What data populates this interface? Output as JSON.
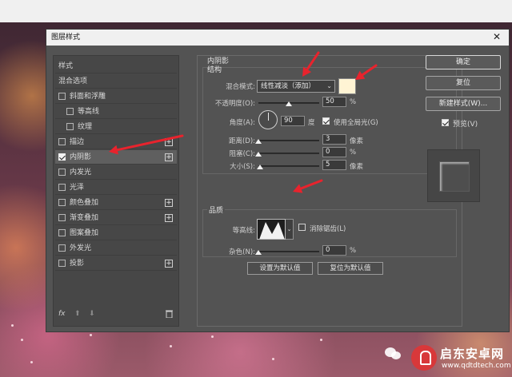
{
  "window": {
    "title": "图层样式"
  },
  "styles_list": {
    "items": [
      {
        "label": "样式",
        "checkbox": false,
        "checked": false,
        "plus": false,
        "selected": false,
        "indent": false
      },
      {
        "label": "混合选项",
        "checkbox": false,
        "checked": false,
        "plus": false,
        "selected": false,
        "indent": false
      },
      {
        "label": "斜面和浮雕",
        "checkbox": true,
        "checked": false,
        "plus": false,
        "selected": false,
        "indent": false
      },
      {
        "label": "等高线",
        "checkbox": true,
        "checked": false,
        "plus": false,
        "selected": false,
        "indent": true
      },
      {
        "label": "纹理",
        "checkbox": true,
        "checked": false,
        "plus": false,
        "selected": false,
        "indent": true
      },
      {
        "label": "描边",
        "checkbox": true,
        "checked": false,
        "plus": true,
        "selected": false,
        "indent": false
      },
      {
        "label": "内阴影",
        "checkbox": true,
        "checked": true,
        "plus": true,
        "selected": true,
        "indent": false
      },
      {
        "label": "内发光",
        "checkbox": true,
        "checked": false,
        "plus": false,
        "selected": false,
        "indent": false
      },
      {
        "label": "光泽",
        "checkbox": true,
        "checked": false,
        "plus": false,
        "selected": false,
        "indent": false
      },
      {
        "label": "颜色叠加",
        "checkbox": true,
        "checked": false,
        "plus": true,
        "selected": false,
        "indent": false
      },
      {
        "label": "渐变叠加",
        "checkbox": true,
        "checked": false,
        "plus": true,
        "selected": false,
        "indent": false
      },
      {
        "label": "图案叠加",
        "checkbox": true,
        "checked": false,
        "plus": false,
        "selected": false,
        "indent": false
      },
      {
        "label": "外发光",
        "checkbox": true,
        "checked": false,
        "plus": false,
        "selected": false,
        "indent": false
      },
      {
        "label": "投影",
        "checkbox": true,
        "checked": false,
        "plus": true,
        "selected": false,
        "indent": false
      }
    ],
    "footer": {
      "fx": "fx",
      "up": "⬆",
      "down": "⬇",
      "trash": "🗑"
    }
  },
  "inner_shadow": {
    "section_title": "内阴影",
    "structure_title": "结构",
    "blend_mode_label": "混合模式:",
    "blend_mode_value": "线性减淡（添加）",
    "shadow_color": "#fff4d4",
    "opacity_label": "不透明度(O):",
    "opacity_value": "50",
    "opacity_fraction": 0.5,
    "angle_label": "角度(A):",
    "angle_value": "90",
    "angle_unit": "度",
    "global_light_label": "使用全局光(G)",
    "global_light_checked": true,
    "distance_label": "距离(D):",
    "distance_value": "3",
    "distance_fraction": 0.0,
    "choke_label": "阻塞(C):",
    "choke_value": "0",
    "choke_fraction": 0.0,
    "size_label": "大小(S):",
    "size_value": "5",
    "size_fraction": 0.02,
    "pixel_unit": "像素",
    "percent_unit": "%",
    "quality_title": "品质",
    "contour_label": "等高线:",
    "anti_alias_label": "消除锯齿(L)",
    "anti_alias_checked": false,
    "noise_label": "杂色(N):",
    "noise_value": "0",
    "noise_fraction": 0.0,
    "make_default": "设置为默认值",
    "reset_default": "复位为默认值"
  },
  "actions": {
    "ok": "确定",
    "reset": "复位",
    "new_style": "新建样式(W)...",
    "preview_label": "预览(V)",
    "preview_checked": true
  },
  "watermark": {
    "title": "启东安卓网",
    "url": "www.qdtdtech.com"
  },
  "colors": {
    "annotation_arrow": "#e8232d",
    "dialog_bg": "#535353"
  }
}
